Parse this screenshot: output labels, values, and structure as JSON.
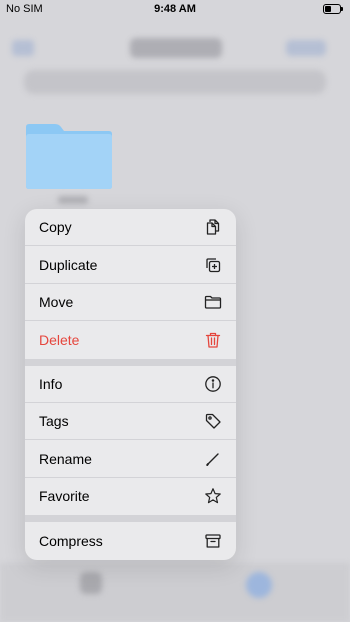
{
  "status_bar": {
    "carrier": "No SIM",
    "time": "9:48 AM"
  },
  "menu": {
    "groups": [
      [
        {
          "label": "Copy",
          "icon": "copy-icon"
        },
        {
          "label": "Duplicate",
          "icon": "duplicate-icon"
        },
        {
          "label": "Move",
          "icon": "folder-icon"
        },
        {
          "label": "Delete",
          "icon": "trash-icon",
          "destructive": true
        }
      ],
      [
        {
          "label": "Info",
          "icon": "info-icon"
        },
        {
          "label": "Tags",
          "icon": "tag-icon"
        },
        {
          "label": "Rename",
          "icon": "pencil-icon"
        },
        {
          "label": "Favorite",
          "icon": "star-icon"
        }
      ],
      [
        {
          "label": "Compress",
          "icon": "archive-icon"
        }
      ]
    ]
  },
  "colors": {
    "destructive": "#e5463d",
    "folder": "#8cc8f4",
    "menu_background": "#eaeaec"
  }
}
